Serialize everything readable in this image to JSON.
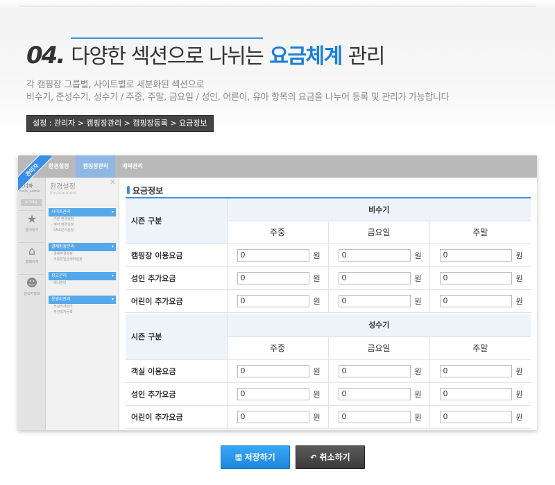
{
  "headline": {
    "number": "04.",
    "text_before": "다양한 섹션으로 나뉘는",
    "highlight": "요금체계",
    "text_after": "관리"
  },
  "description": {
    "line1": "각 캠핑장 그룹별,  사이트별로 세분화된 섹션으로",
    "line2": "비수기, 준성수기, 성수기 / 주중, 주말, 금요일 / 성인, 어른이, 유아 항목의 요금을 나누어 등록 및 관리가 가능합니다"
  },
  "breadcrumb": "설정 : 관리자 > 캠핑장관리 > 캠핑장등록 > 요금정보",
  "screenshot": {
    "ribbon": "관리자",
    "topnav": [
      "환경설정",
      "캠핑장관리",
      "예약관리"
    ],
    "leftbar": {
      "title": "관리자",
      "sub": "hello_admin",
      "button": "로그아웃",
      "icons": [
        {
          "icon": "star-icon",
          "caption": "즐겨찾기"
        },
        {
          "icon": "home-icon",
          "caption": "홈페이지"
        },
        {
          "icon": "user-settings-icon",
          "caption": "관리자정보"
        }
      ]
    },
    "panel": {
      "title": "환경설정",
      "subtitle": "Environment",
      "sections": [
        {
          "label": "사이트관리",
          "items": [
            "· 기본 환경설정",
            "· 예약 환경설정",
            "· SMS문자설정"
          ]
        },
        {
          "label": "결제환경관리",
          "items": [
            "· 결제환경설정",
            "· 무통장입금계좌설정"
          ]
        },
        {
          "label": "광고관리",
          "items": [
            "· 배너관리"
          ]
        },
        {
          "label": "운영자관리",
          "items": [
            "· 부관리자관리",
            "· 부관리자등록"
          ]
        }
      ]
    },
    "content": {
      "title": "요금정보",
      "table1": {
        "season": "비수기",
        "label": "시즌 구분",
        "columns": [
          "주중",
          "금요일",
          "주말"
        ],
        "rows": [
          {
            "label": "캠핑장 이용요금",
            "values": [
              "0",
              "0",
              "0"
            ]
          },
          {
            "label": "성인 추가요금",
            "values": [
              "0",
              "0",
              "0"
            ]
          },
          {
            "label": "어린이 추가요금",
            "values": [
              "0",
              "0",
              "0"
            ]
          }
        ]
      },
      "table2": {
        "season": "성수기",
        "label": "시즌 구분",
        "columns": [
          "주중",
          "금요일",
          "주말"
        ],
        "rows": [
          {
            "label": "객실 이용요금",
            "values": [
              "0",
              "0",
              "0"
            ]
          },
          {
            "label": "성인 추가요금",
            "values": [
              "0",
              "0",
              "0"
            ]
          },
          {
            "label": "어린이 추가요금",
            "values": [
              "0",
              "0",
              "0"
            ]
          }
        ]
      },
      "unit": "원"
    }
  },
  "buttons": {
    "save": "저장하기",
    "cancel": "취소하기"
  },
  "colors": {
    "accent": "#1a7fd6",
    "save_button": "#2a93e8",
    "cancel_button": "#4a4a4a"
  }
}
